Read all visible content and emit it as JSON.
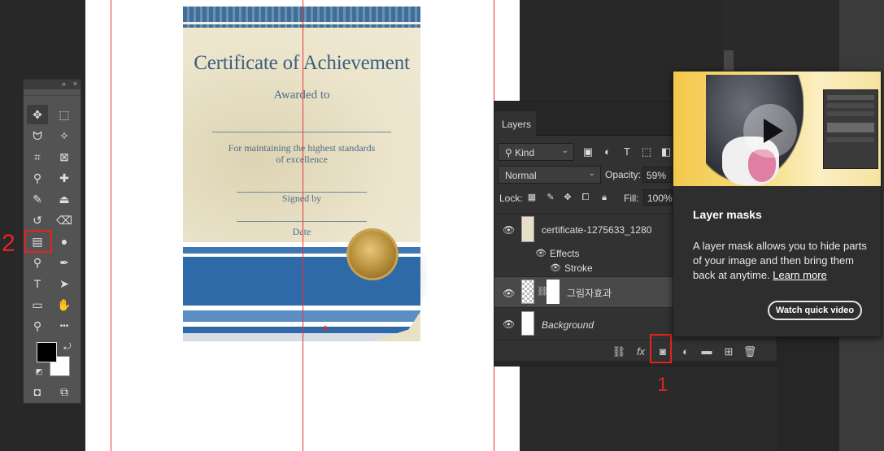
{
  "certificate": {
    "title": "Certificate of Achievement",
    "awarded": "Awarded to",
    "line1": "For maintaining the highest standards",
    "line2": "of excellence",
    "signed": "Signed by",
    "date": "Date"
  },
  "canvas_marker": "+",
  "tools": {
    "collapse": "«",
    "close": "×",
    "items": [
      {
        "name": "move-tool-icon",
        "glyph": "✥"
      },
      {
        "name": "marquee-tool-icon",
        "glyph": "⬚"
      },
      {
        "name": "lasso-tool-icon",
        "glyph": "ᗢ"
      },
      {
        "name": "magic-wand-tool-icon",
        "glyph": "✧"
      },
      {
        "name": "crop-tool-icon",
        "glyph": "⌗"
      },
      {
        "name": "frame-tool-icon",
        "glyph": "⊠"
      },
      {
        "name": "eyedropper-tool-icon",
        "glyph": "⚲"
      },
      {
        "name": "healing-brush-tool-icon",
        "glyph": "✚"
      },
      {
        "name": "brush-tool-icon",
        "glyph": "✎"
      },
      {
        "name": "clone-stamp-tool-icon",
        "glyph": "⏏"
      },
      {
        "name": "history-brush-tool-icon",
        "glyph": "↺"
      },
      {
        "name": "eraser-tool-icon",
        "glyph": "⌫"
      },
      {
        "name": "gradient-tool-icon",
        "glyph": "▤"
      },
      {
        "name": "blur-tool-icon",
        "glyph": "●"
      },
      {
        "name": "dodge-tool-icon",
        "glyph": "⚲"
      },
      {
        "name": "pen-tool-icon",
        "glyph": "✒"
      },
      {
        "name": "type-tool-icon",
        "glyph": "T"
      },
      {
        "name": "path-selection-tool-icon",
        "glyph": "➤"
      },
      {
        "name": "rectangle-tool-icon",
        "glyph": "▭"
      },
      {
        "name": "hand-tool-icon",
        "glyph": "✋"
      },
      {
        "name": "zoom-tool-icon",
        "glyph": "⚲"
      },
      {
        "name": "more-tools-icon",
        "glyph": "•••"
      }
    ],
    "bottom": [
      {
        "name": "quick-mask-icon",
        "glyph": "◘"
      },
      {
        "name": "screen-mode-icon",
        "glyph": "⧉"
      }
    ]
  },
  "annotations": {
    "one": "1",
    "two": "2"
  },
  "layers_panel": {
    "tab": "Layers",
    "kind_label": "Kind",
    "blend_mode": "Normal",
    "opacity_label": "Opacity:",
    "opacity_value": "59%",
    "lock_label": "Lock:",
    "fill_label": "Fill:",
    "fill_value": "100%",
    "layers": [
      {
        "name": "certificate-1275633_1280",
        "italic": false
      },
      {
        "name": "Effects",
        "italic": false
      },
      {
        "name": "Stroke",
        "italic": false
      },
      {
        "name": "그림자효과",
        "italic": false
      },
      {
        "name": "Background",
        "italic": true
      }
    ],
    "footer_icons": [
      "link-layers-icon",
      "fx-icon",
      "add-layer-mask-icon",
      "adjustment-layer-icon",
      "group-folder-icon",
      "new-layer-icon",
      "trash-icon"
    ]
  },
  "tooltip_card": {
    "title": "Layer masks",
    "body": "A layer mask allows you to hide parts of your image and then bring them back at anytime.",
    "link": "Learn more",
    "button": "Watch quick video"
  },
  "colors": {
    "accent_red": "#e3241e",
    "panel_bg": "#323232",
    "canvas_bg": "#ffffff"
  }
}
